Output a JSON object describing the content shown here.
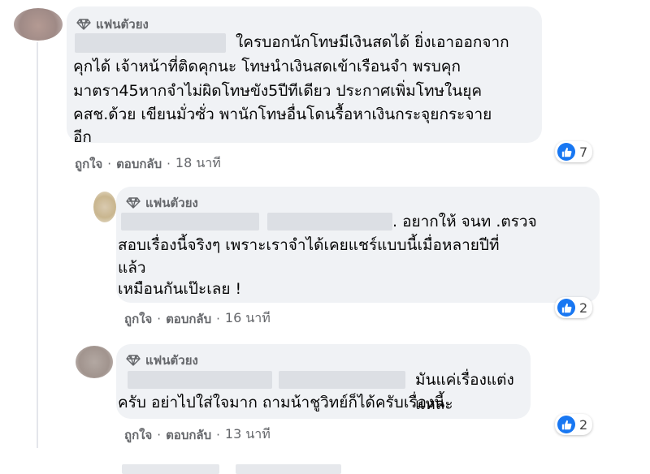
{
  "comments": [
    {
      "badge": "แฟนตัวยง",
      "text": "ใครบอกนักโทษมีเงินสดได้ ยิ่งเอาออกจากคุกได้ เจ้าหน้าที่ติดคุกนะ โทษนำเงินสดเข้าเรือนจำ พรบคุกมาตรา45หากจำไม่ผิดโทษขัง5ปีทีเดียว ประกาศเพิ่มโทษในยุคคสช.ด้วย เขียนมั่วซั่ว พานักโทษอื่นโดนรื้อหาเงินกระจุยกระจายอีก",
      "lines": [
        "ใครบอกนักโทษมีเงินสดได้ ยิ่งเอาออกจาก",
        "คุกได้ เจ้าหน้าที่ติดคุกนะ โทษนำเงินสดเข้าเรือนจำ พรบคุก",
        "มาตรา45หากจำไม่ผิดโทษขัง5ปีทีเดียว ประกาศเพิ่มโทษในยุค",
        "คสช.ด้วย เขียนมั่วซั่ว พานักโทษอื่นโดนรื้อหาเงินกระจุยกระจาย",
        "อีก"
      ],
      "like_label": "ถูกใจ",
      "reply_label": "ตอบกลับ",
      "time": "18 นาที",
      "reactions": "7"
    },
    {
      "badge": "แฟนตัวยง",
      "lines": [
        ". อยากให้ จนท .ตรวจ",
        "สอบเรื่องนี้จริงๆ เพราะเราจำได้เคยแชร์แบบนี้เมื่อหลายปีที่",
        "แล้ว",
        "เหมือนกันเป๊ะเลย !"
      ],
      "like_label": "ถูกใจ",
      "reply_label": "ตอบกลับ",
      "time": "16 นาที",
      "reactions": "2"
    },
    {
      "badge": "แฟนตัวยง",
      "lines": [
        "มันแค่เรื่องแต่งแหละ",
        "ครับ อย่าไปใส่ใจมาก ถามน้าชูวิทย์ก็ได้ครับเรื่องนี้"
      ],
      "like_label": "ถูกใจ",
      "reply_label": "ตอบกลับ",
      "time": "13 นาที",
      "reactions": "2"
    }
  ],
  "icons": {
    "badge": "diamond-icon",
    "reaction": "thumbs-up-icon"
  },
  "colors": {
    "bubble": "#f0f2f5",
    "like_blue": "#1877f2",
    "meta_gray": "#65676b"
  }
}
